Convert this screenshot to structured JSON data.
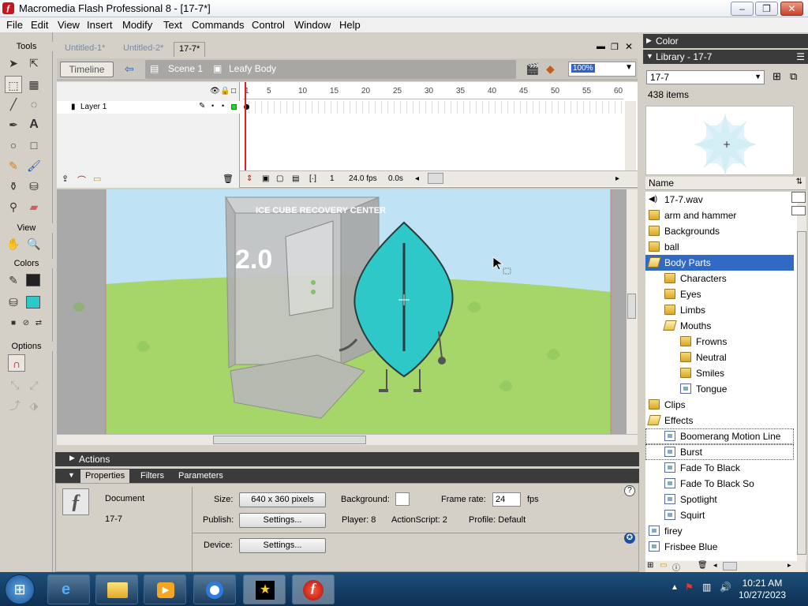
{
  "window": {
    "title": "Macromedia Flash Professional 8 - [17-7*]"
  },
  "menu": [
    "File",
    "Edit",
    "View",
    "Insert",
    "Modify",
    "Text",
    "Commands",
    "Control",
    "Window",
    "Help"
  ],
  "tools": {
    "title": "Tools",
    "view": "View",
    "colors": "Colors",
    "options": "Options"
  },
  "doc_tabs": [
    "Untitled-1*",
    "Untitled-2*",
    "17-7*"
  ],
  "editbar": {
    "timeline": "Timeline",
    "scene": "Scene 1",
    "symbol": "Leafy Body",
    "zoom": "100%"
  },
  "timeline": {
    "layer": "Layer 1",
    "ruler": [
      "1",
      "5",
      "10",
      "15",
      "20",
      "25",
      "30",
      "35",
      "40",
      "45",
      "50",
      "55",
      "60"
    ],
    "frame": "1",
    "fps": "24.0 fps",
    "time": "0.0s"
  },
  "stage": {
    "machine_title": "ICE CUBE RECOVERY CENTER",
    "machine_version": "2.0",
    "sky_color": "#bfe3f4",
    "grass_color": "#a6d56a",
    "leafy_color": "#2ec8c8"
  },
  "actions": "Actions",
  "props": {
    "tabs": [
      "Properties",
      "Filters",
      "Parameters"
    ],
    "type": "Document",
    "name": "17-7",
    "size_label": "Size:",
    "size_value": "640 x 360 pixels",
    "bg_label": "Background:",
    "fr_label": "Frame rate:",
    "fr_value": "24",
    "fr_unit": "fps",
    "publish_label": "Publish:",
    "settings": "Settings...",
    "player": "Player: 8",
    "actionscript": "ActionScript: 2",
    "profile": "Profile: Default",
    "device_label": "Device:"
  },
  "panels": {
    "color": "Color",
    "library": "Library - 17-7"
  },
  "library": {
    "doc": "17-7",
    "count": "438 items",
    "column": "Name",
    "items": [
      {
        "label": "17-7.wav",
        "icon": "sound",
        "indent": 0
      },
      {
        "label": "arm and hammer",
        "icon": "folder",
        "indent": 0
      },
      {
        "label": "Backgrounds",
        "icon": "folder",
        "indent": 0
      },
      {
        "label": "ball",
        "icon": "folder",
        "indent": 0
      },
      {
        "label": "Body Parts",
        "icon": "folder-open",
        "indent": 0,
        "selected": true
      },
      {
        "label": "Characters",
        "icon": "folder",
        "indent": 1
      },
      {
        "label": "Eyes",
        "icon": "folder",
        "indent": 1
      },
      {
        "label": "Limbs",
        "icon": "folder",
        "indent": 1
      },
      {
        "label": "Mouths",
        "icon": "folder-open",
        "indent": 1
      },
      {
        "label": "Frowns",
        "icon": "folder",
        "indent": 2
      },
      {
        "label": "Neutral",
        "icon": "folder",
        "indent": 2
      },
      {
        "label": "Smiles",
        "icon": "folder",
        "indent": 2
      },
      {
        "label": "Tongue",
        "icon": "symbol",
        "indent": 2
      },
      {
        "label": "Clips",
        "icon": "folder",
        "indent": 0
      },
      {
        "label": "Effects",
        "icon": "folder-open",
        "indent": 0
      },
      {
        "label": "Boomerang Motion Line",
        "icon": "symbol",
        "indent": 1,
        "dotted": true
      },
      {
        "label": "Burst",
        "icon": "symbol",
        "indent": 1,
        "dotted": true
      },
      {
        "label": "Fade To Black",
        "icon": "symbol",
        "indent": 1
      },
      {
        "label": "Fade To Black So",
        "icon": "symbol",
        "indent": 1
      },
      {
        "label": "Spotlight",
        "icon": "symbol",
        "indent": 1
      },
      {
        "label": "Squirt",
        "icon": "symbol",
        "indent": 1
      },
      {
        "label": "firey",
        "icon": "symbol",
        "indent": 0
      },
      {
        "label": "Frisbee Blue",
        "icon": "symbol",
        "indent": 0
      }
    ]
  },
  "taskbar": {
    "time": "10:21 AM",
    "date": "10/27/2023"
  }
}
